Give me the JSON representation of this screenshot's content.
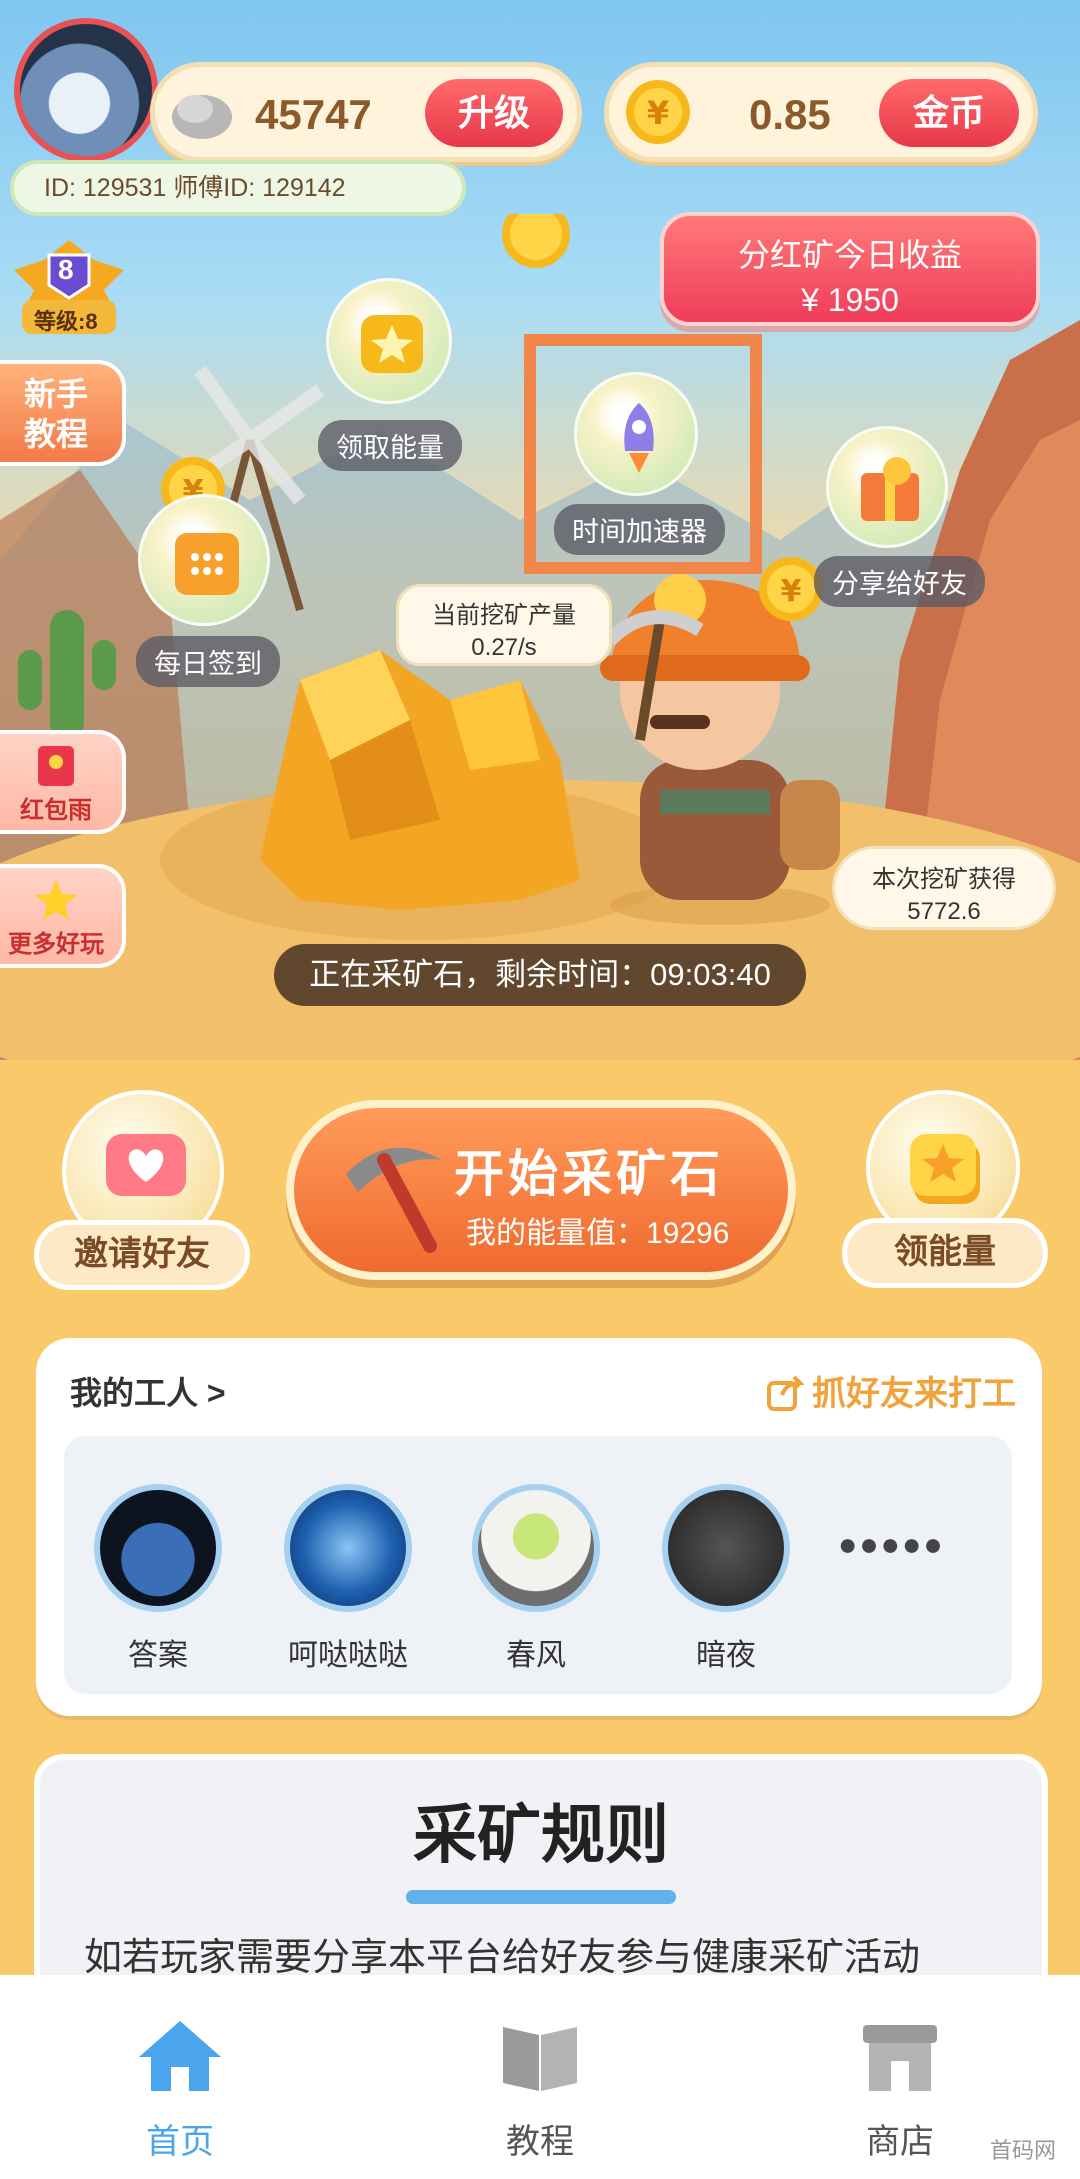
{
  "header": {
    "stone_amount": "45747",
    "upgrade_label": "升级",
    "coin_amount": "0.85",
    "coin_label": "金币",
    "id_text": "ID: 129531  师傅ID: 129142"
  },
  "level": {
    "number": "8",
    "label": "等级:8"
  },
  "dividend": {
    "title": "分红矿今日收益",
    "amount": "¥ 1950"
  },
  "side_menu": {
    "tutorial": "新手\n教程",
    "red_packet": "红包雨",
    "more_play": "更多好玩"
  },
  "bubbles": {
    "energy": "领取能量",
    "speedup": "时间加速器",
    "share": "分享给好友",
    "checkin": "每日签到"
  },
  "mining": {
    "output_label": "当前挖矿产量",
    "output_value": "0.27/s",
    "earned_label": "本次挖矿获得",
    "earned_value": "5772.6",
    "timer_text": "正在采矿石，剩余时间：09:03:40"
  },
  "actions": {
    "invite": "邀请好友",
    "start_title": "开始采矿石",
    "energy_value": "我的能量值：19296",
    "get_energy": "领能量"
  },
  "workers": {
    "title": "我的工人 >",
    "catch_friends": "抓好友来打工",
    "list": [
      "答案",
      "呵哒哒哒",
      "春风",
      "暗夜"
    ],
    "more": "●●●●●"
  },
  "rules": {
    "title": "采矿规则",
    "text": "如若玩家需要分享本平台给好友参与健康采矿活动"
  },
  "tabbar": {
    "home": "首页",
    "tutorial": "教程",
    "shop": "商店"
  },
  "watermark": "首码网"
}
